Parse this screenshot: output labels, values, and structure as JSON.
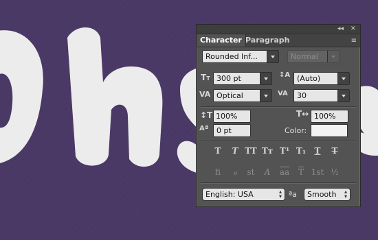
{
  "artwork": {
    "text": "Ohs",
    "text_color": "#ececec",
    "background_color": "#4a3866"
  },
  "panel": {
    "tabs": [
      {
        "label": "Character",
        "active": true
      },
      {
        "label": "Paragraph",
        "active": false
      }
    ],
    "controls": {
      "collapse_icon": "double-chevron-left",
      "close_icon": "close-x"
    },
    "font_family": "Rounded Inf...",
    "font_style": "Normal",
    "font_size": "300 pt",
    "leading": "(Auto)",
    "kerning": "Optical",
    "tracking": "30",
    "vertical_scale": "100%",
    "horizontal_scale": "100%",
    "baseline_shift": "0 pt",
    "color_label": "Color:",
    "color_value": "#f2f2f2",
    "style_buttons": [
      "T",
      "T",
      "TT",
      "Tт",
      "T¹",
      "T₁",
      "T",
      "T"
    ],
    "opentype_buttons": [
      "fi",
      "ℴ",
      "st",
      "A",
      "aa",
      "T",
      "1st",
      "½"
    ],
    "language": "English: USA",
    "aa_icon": "ªa",
    "anti_alias": "Smooth"
  }
}
